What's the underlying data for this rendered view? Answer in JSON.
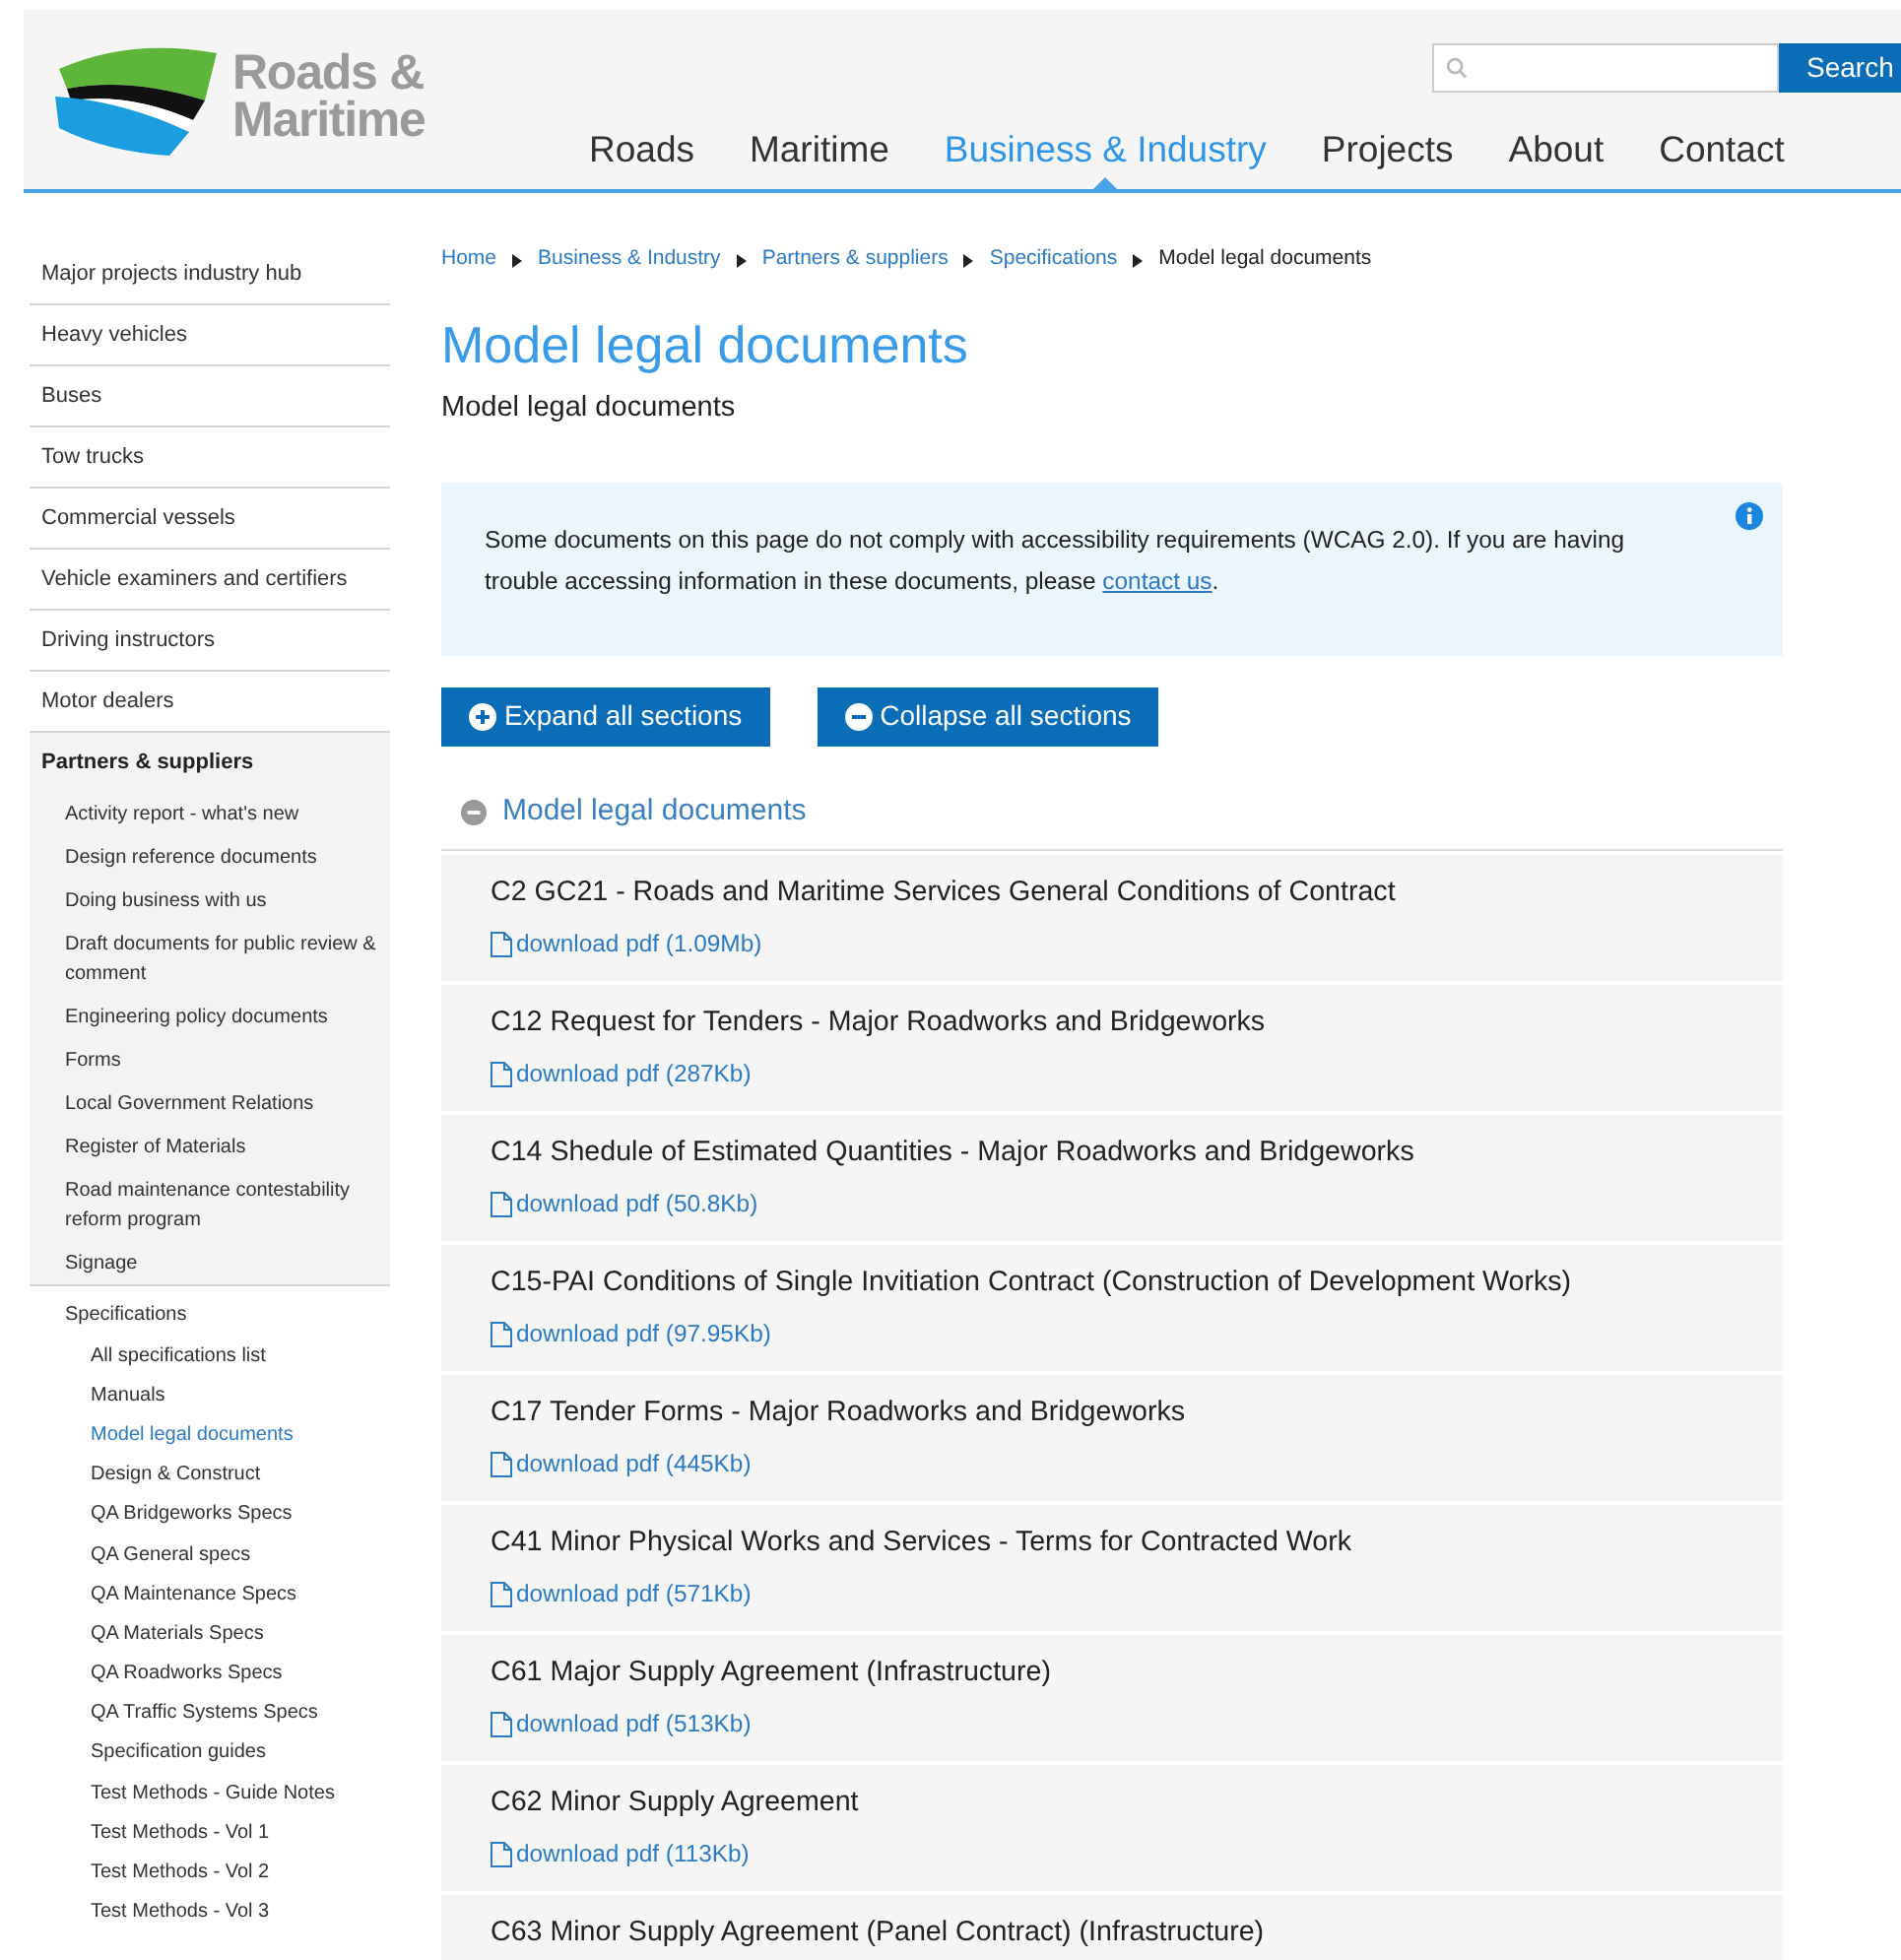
{
  "header": {
    "logo_text": "Roads & Maritime",
    "search_button": "Search",
    "nav": [
      {
        "label": "Roads",
        "selected": false
      },
      {
        "label": "Maritime",
        "selected": false
      },
      {
        "label": "Business & Industry",
        "selected": true
      },
      {
        "label": "Projects",
        "selected": false
      },
      {
        "label": "About",
        "selected": false
      },
      {
        "label": "Contact",
        "selected": false
      }
    ]
  },
  "sidebar": {
    "items": [
      {
        "label": "Major projects industry hub",
        "selected": false
      },
      {
        "label": "Heavy vehicles",
        "selected": false
      },
      {
        "label": "Buses",
        "selected": false
      },
      {
        "label": "Tow trucks",
        "selected": false
      },
      {
        "label": "Commercial vessels",
        "selected": false
      },
      {
        "label": "Vehicle examiners and certifiers",
        "selected": false
      },
      {
        "label": "Driving instructors",
        "selected": false
      },
      {
        "label": "Motor dealers",
        "selected": false
      },
      {
        "label": "Partners & suppliers",
        "selected": false,
        "children": [
          {
            "label": "Activity report - what's new",
            "selected": false
          },
          {
            "label": "Design reference documents",
            "selected": false
          },
          {
            "label": "Doing business with us",
            "selected": false
          },
          {
            "label": "Draft documents for public review & comment",
            "selected": false
          },
          {
            "label": "Engineering policy documents",
            "selected": false
          },
          {
            "label": "Forms",
            "selected": false
          },
          {
            "label": "Local Government Relations",
            "selected": false
          },
          {
            "label": "Register of Materials",
            "selected": false
          },
          {
            "label": "Road maintenance contestability reform program",
            "selected": false
          },
          {
            "label": "Signage",
            "selected": false
          },
          {
            "label": "Specifications",
            "selected": false,
            "children": [
              {
                "label": "All specifications list",
                "selected": false
              },
              {
                "label": "Manuals",
                "selected": false
              },
              {
                "label": "Model legal documents",
                "selected": true
              },
              {
                "label": "Design & Construct",
                "selected": false
              },
              {
                "label": "QA Bridgeworks Specs",
                "selected": false
              },
              {
                "label": "QA General specs",
                "selected": false
              },
              {
                "label": "QA Maintenance Specs",
                "selected": false
              },
              {
                "label": "QA Materials Specs",
                "selected": false
              },
              {
                "label": "QA Roadworks Specs",
                "selected": false
              },
              {
                "label": "QA Traffic Systems Specs",
                "selected": false
              },
              {
                "label": "Specification guides",
                "selected": false
              },
              {
                "label": "Test Methods - Guide Notes",
                "selected": false
              },
              {
                "label": "Test Methods - Vol 1",
                "selected": false
              },
              {
                "label": "Test Methods - Vol 2",
                "selected": false
              },
              {
                "label": "Test Methods - Vol 3",
                "selected": false
              }
            ]
          }
        ]
      }
    ]
  },
  "breadcrumb": [
    {
      "label": "Home",
      "kind": "link"
    },
    {
      "label": "Business & Industry",
      "kind": "link"
    },
    {
      "label": "Partners & suppliers",
      "kind": "link"
    },
    {
      "label": "Specifications",
      "kind": "link"
    },
    {
      "label": "Model legal documents",
      "kind": "current"
    }
  ],
  "page_title": "Model legal documents",
  "subtitle": "Model legal documents",
  "notice": {
    "text": "Some documents on this page do not comply with accessibility requirements (WCAG 2.0). If you are having trouble accessing information in these documents, please",
    "link": "contact us",
    "after": "."
  },
  "buttons": [
    {
      "label": "Expand all sections",
      "kind": "expand"
    },
    {
      "label": "Collapse all sections",
      "kind": "collapse"
    }
  ],
  "section": {
    "title": "Model legal documents",
    "expanded": true,
    "documents": [
      {
        "title": "C2 GC21 - Roads and Maritime Services General Conditions of Contract",
        "link": "download pdf (1.09Mb)"
      },
      {
        "title": "C12 Request for Tenders - Major Roadworks and Bridgeworks",
        "link": "download pdf (287Kb)"
      },
      {
        "title": "C14 Shedule of Estimated Quantities - Major Roadworks and Bridgeworks",
        "link": "download pdf (50.8Kb)"
      },
      {
        "title": "C15-PAI Conditions of Single Invitiation Contract (Construction of Development Works)",
        "link": "download pdf (97.95Kb)"
      },
      {
        "title": "C17 Tender Forms - Major Roadworks and Bridgeworks",
        "link": "download pdf (445Kb)"
      },
      {
        "title": "C41 Minor Physical Works and Services - Terms for Contracted Work",
        "link": "download pdf (571Kb)"
      },
      {
        "title": "C61 Major Supply Agreement (Infrastructure)",
        "link": "download pdf (513Kb)"
      },
      {
        "title": "C62 Minor Supply Agreement",
        "link": "download pdf (113Kb)"
      },
      {
        "title": "C63 Minor Supply Agreement (Panel Contract) (Infrastructure)"
      }
    ]
  }
}
